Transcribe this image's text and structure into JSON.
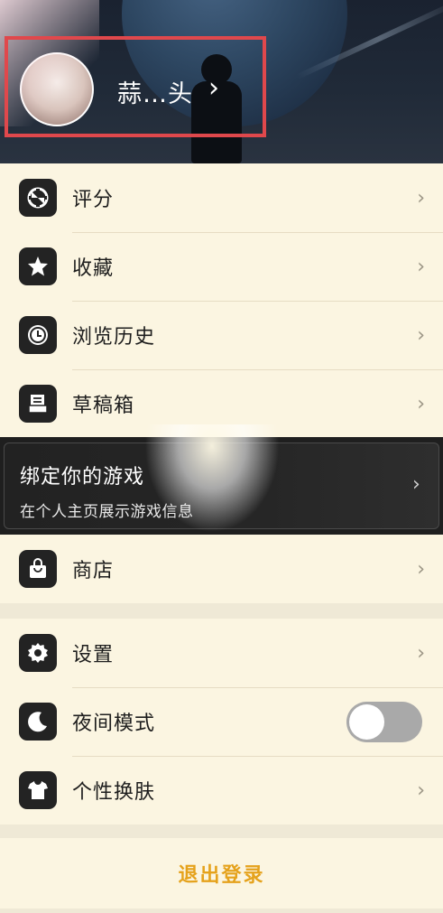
{
  "profile": {
    "username": "蒜…头",
    "chevron": "›"
  },
  "menu_top": [
    {
      "label": "评分",
      "icon": "rating-icon"
    },
    {
      "label": "收藏",
      "icon": "star-icon"
    },
    {
      "label": "浏览历史",
      "icon": "clock-icon"
    },
    {
      "label": "草稿箱",
      "icon": "drafts-icon"
    }
  ],
  "banner": {
    "title": "绑定你的游戏",
    "subtitle": "在个人主页展示游戏信息",
    "chevron": "›"
  },
  "menu_shop": [
    {
      "label": "商店",
      "icon": "shop-bag-icon"
    }
  ],
  "menu_settings": [
    {
      "label": "设置",
      "icon": "gear-icon"
    },
    {
      "label": "夜间模式",
      "icon": "moon-icon",
      "toggle": false
    },
    {
      "label": "个性换肤",
      "icon": "tshirt-icon"
    }
  ],
  "logout": {
    "label": "退出登录"
  },
  "colors": {
    "background": "#efe9d6",
    "card": "#fbf5e1",
    "logout_text": "#e5a21c",
    "highlight_border": "#e0484c"
  },
  "chevron": "›"
}
